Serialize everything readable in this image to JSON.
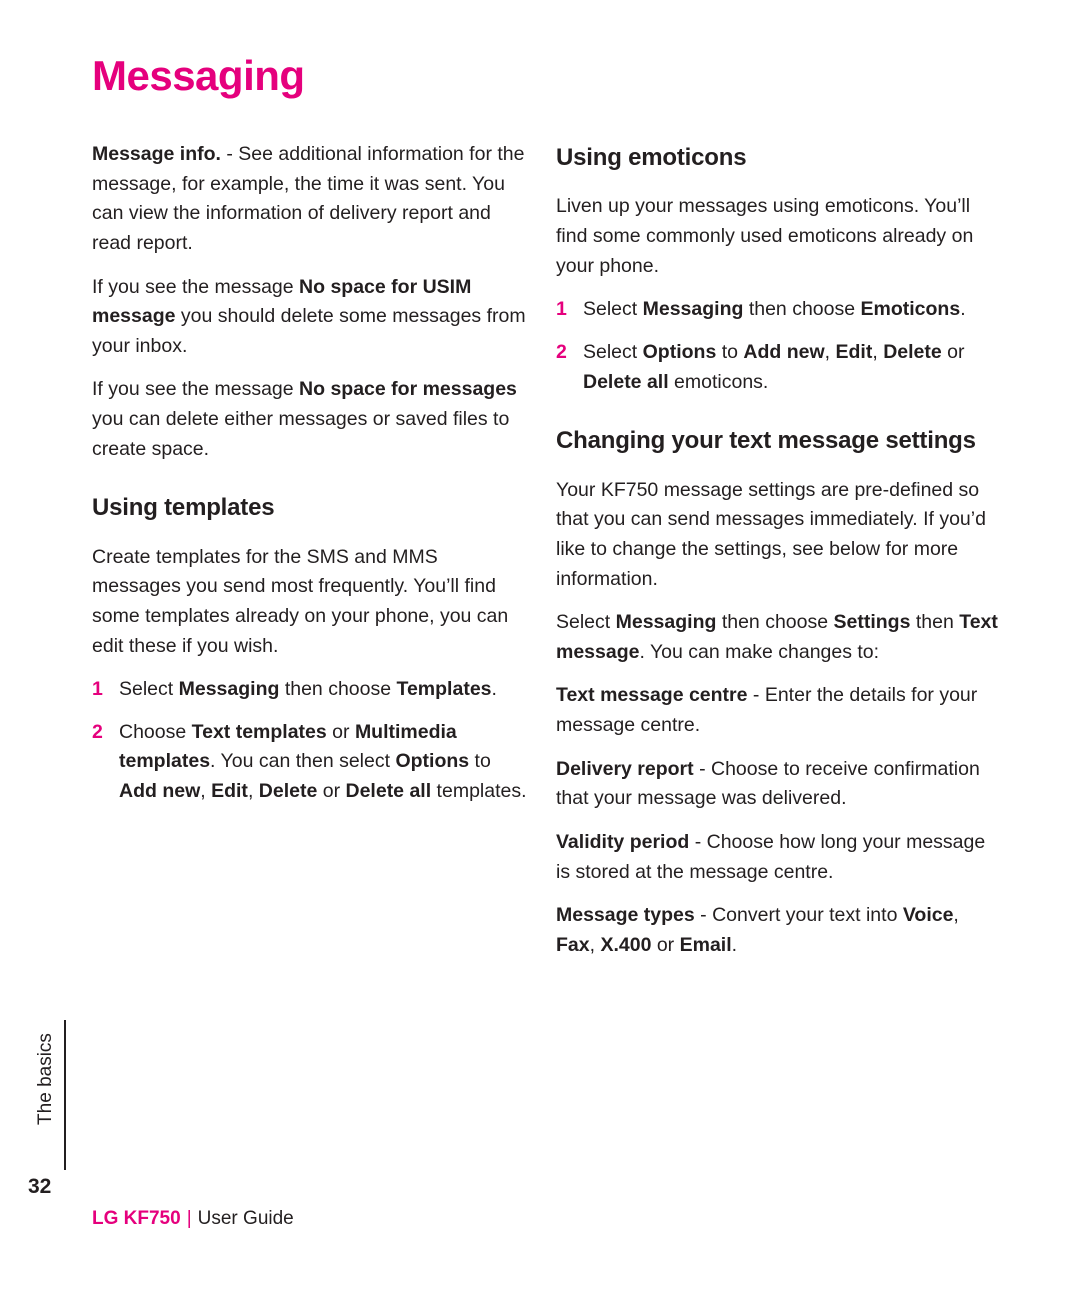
{
  "document": {
    "title": "Messaging",
    "page_number": "32",
    "side_tab": "The basics",
    "footer": {
      "brand": "LG KF750",
      "separator": "|",
      "guide": "User Guide"
    }
  },
  "left_column": {
    "para_message_info": {
      "lead": "Message info.",
      "rest": " - See additional information for the message, for example, the time it was sent. You can view the information of delivery report and read report."
    },
    "para_no_space_usim": {
      "pre": "If you see the message ",
      "bold1": "No space for USIM message",
      "post": " you should delete some messages from your inbox."
    },
    "para_no_space_messages": {
      "pre": "If you see the message ",
      "bold1": "No space for messages",
      "post": " you can delete either messages or saved files to create space."
    },
    "heading_templates": "Using templates",
    "para_templates": "Create templates for the SMS and MMS messages you send most frequently. You’ll find some templates already on your phone, you can edit these if you wish.",
    "step1": {
      "num": "1",
      "pre": "Select ",
      "bold1": "Messaging",
      "mid": " then choose ",
      "bold2": "Templates",
      "post": "."
    },
    "step2": {
      "num": "2",
      "pre": "Choose ",
      "bold1": "Text templates",
      "mid1": " or ",
      "bold2": "Multimedia templates",
      "mid2": ". You can then select ",
      "bold3": "Options",
      "mid3": " to ",
      "bold4": "Add new",
      "comma1": ", ",
      "bold5": "Edit",
      "comma2": ", ",
      "bold6": "Delete",
      "mid4": " or ",
      "bold7": "Delete all",
      "post": " templates."
    }
  },
  "right_column": {
    "heading_emoticons": "Using emoticons",
    "para_emoticons": "Liven up your messages using emoticons. You’ll find some commonly used emoticons already on your phone.",
    "step1": {
      "num": "1",
      "pre": "Select ",
      "bold1": "Messaging",
      "mid": " then choose ",
      "bold2": "Emoticons",
      "post": "."
    },
    "step2": {
      "num": "2",
      "pre": "Select ",
      "bold1": "Options",
      "mid1": " to ",
      "bold2": "Add new",
      "comma1": ", ",
      "bold3": "Edit",
      "comma2": ", ",
      "bold4": "Delete",
      "mid2": " or ",
      "bold5": "Delete all",
      "post": " emoticons."
    },
    "heading_settings": "Changing your text message settings",
    "para_settings": "Your KF750 message settings are pre-defined so that you can send messages immediately. If you’d like to change the settings, see below for more information.",
    "para_select": {
      "pre": "Select ",
      "bold1": "Messaging",
      "mid1": " then choose ",
      "bold2": "Settings",
      "mid2": " then ",
      "bold3": "Text message",
      "post": ". You can make changes to:"
    },
    "item_centre": {
      "lead": "Text message centre",
      "rest": " - Enter the details for your message centre."
    },
    "item_delivery": {
      "lead": "Delivery report",
      "rest": " - Choose to receive confirmation that your message was delivered."
    },
    "item_validity": {
      "lead": "Validity period",
      "rest": " - Choose how long your message is stored at the message centre."
    },
    "item_types": {
      "lead": "Message types",
      "mid": " - Convert your text into ",
      "bold1": "Voice",
      "comma1": ", ",
      "bold2": "Fax",
      "comma2": ", ",
      "bold3": "X.400",
      "mid2": " or ",
      "bold4": "Email",
      "post": "."
    }
  },
  "colors": {
    "accent": "#e5007d",
    "text": "#231f20",
    "background": "#ffffff"
  }
}
